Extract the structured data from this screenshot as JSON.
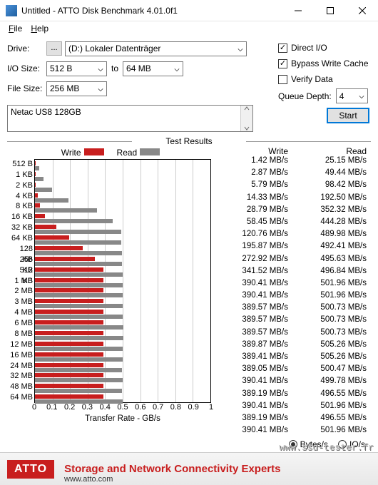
{
  "window": {
    "title": "Untitled - ATTO Disk Benchmark 4.01.0f1"
  },
  "menu": {
    "file": "File",
    "help": "Help"
  },
  "controls": {
    "drive_label": "Drive:",
    "drive_btn": "...",
    "drive_value": "(D:) Lokaler Datenträger",
    "iosize_label": "I/O Size:",
    "iosize_from": "512 B",
    "to": "to",
    "iosize_to": "64 MB",
    "filesize_label": "File Size:",
    "filesize_value": "256 MB",
    "direct_io": "Direct I/O",
    "bypass": "Bypass Write Cache",
    "verify": "Verify Data",
    "queue_label": "Queue Depth:",
    "queue_value": "4",
    "device": "Netac US8 128GB",
    "start": "Start"
  },
  "results": {
    "header": "Test Results",
    "write_label": "Write",
    "read_label": "Read",
    "bytes": "Bytes/s",
    "ios": "IO/s",
    "xaxis_title": "Transfer Rate - GB/s"
  },
  "chart_data": {
    "type": "bar",
    "xlabel": "Transfer Rate - GB/s",
    "xlim": [
      0,
      1
    ],
    "xticks": [
      0,
      0.1,
      0.2,
      0.3,
      0.4,
      0.5,
      0.6,
      0.7,
      0.8,
      0.9,
      1
    ],
    "categories": [
      "512 B",
      "1 KB",
      "2 KB",
      "4 KB",
      "8 KB",
      "16 KB",
      "32 KB",
      "64 KB",
      "128 KB",
      "256 KB",
      "512 KB",
      "1 MB",
      "2 MB",
      "3 MB",
      "4 MB",
      "6 MB",
      "8 MB",
      "12 MB",
      "16 MB",
      "24 MB",
      "32 MB",
      "48 MB",
      "64 MB"
    ],
    "series": [
      {
        "name": "Write",
        "color": "#c81e1e",
        "units": "MB/s",
        "values": [
          1.42,
          2.87,
          5.79,
          14.33,
          28.79,
          58.45,
          120.76,
          195.87,
          272.92,
          341.52,
          390.41,
          390.41,
          389.57,
          389.57,
          389.57,
          389.87,
          389.41,
          389.05,
          390.41,
          389.19,
          390.41,
          389.19,
          390.41
        ]
      },
      {
        "name": "Read",
        "color": "#888888",
        "units": "MB/s",
        "values": [
          25.15,
          49.44,
          98.42,
          192.5,
          352.32,
          444.28,
          489.98,
          492.41,
          495.63,
          496.84,
          501.96,
          501.96,
          500.73,
          500.73,
          500.73,
          505.26,
          505.26,
          500.47,
          499.78,
          496.55,
          501.96,
          496.55,
          501.96
        ]
      }
    ]
  },
  "footer": {
    "brand": "ATTO",
    "tagline": "Storage and Network Connectivity Experts",
    "url": "www.atto.com"
  },
  "watermark": "www.ssd-tester.fr"
}
